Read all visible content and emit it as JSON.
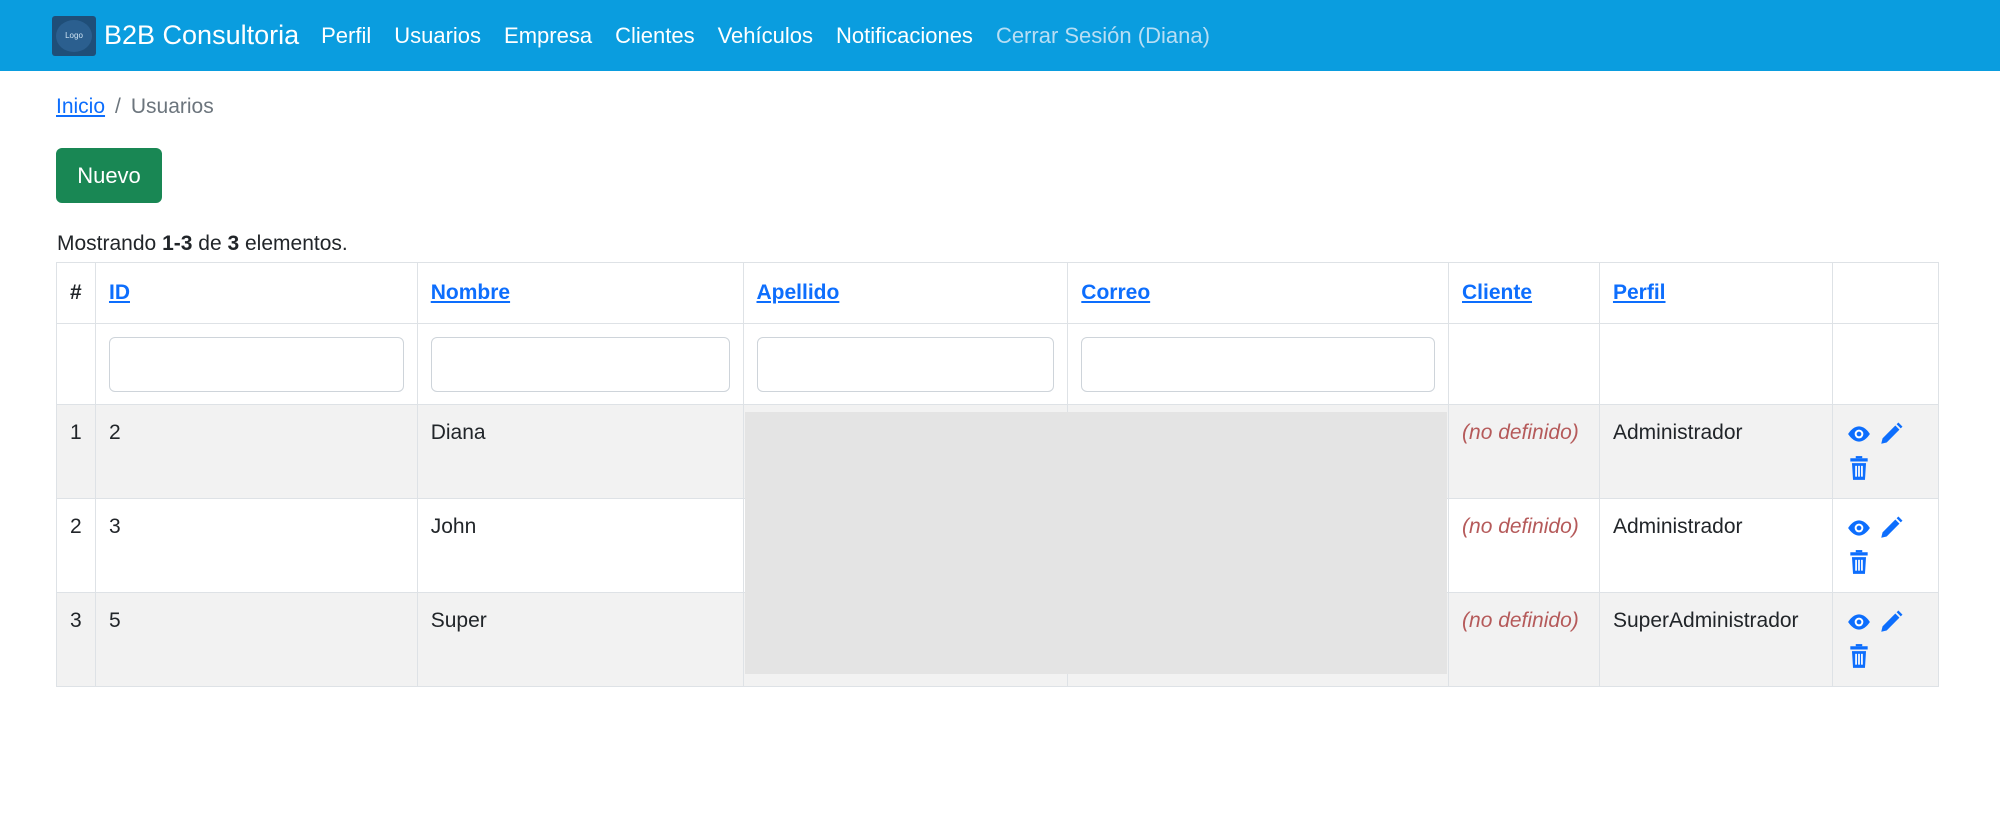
{
  "navbar": {
    "logo_text": "Logo",
    "brand": "B2B Consultoria",
    "links": [
      "Perfil",
      "Usuarios",
      "Empresa",
      "Clientes",
      "Vehículos",
      "Notificaciones"
    ],
    "logout": "Cerrar Sesión (Diana)"
  },
  "breadcrumb": {
    "home": "Inicio",
    "separator": "/",
    "current": "Usuarios"
  },
  "new_button": "Nuevo",
  "summary": {
    "prefix": "Mostrando",
    "range": "1-3",
    "middle": "de",
    "total": "3",
    "suffix": "elementos."
  },
  "table": {
    "headers": [
      "#",
      "ID",
      "Nombre",
      "Apellido",
      "Correo",
      "Cliente",
      "Perfil"
    ],
    "rows": [
      {
        "num": "1",
        "id": "2",
        "nombre": "Diana",
        "cliente": "(no definido)",
        "perfil": "Administrador"
      },
      {
        "num": "2",
        "id": "3",
        "nombre": "John",
        "cliente": "(no definido)",
        "perfil": "Administrador"
      },
      {
        "num": "3",
        "id": "5",
        "nombre": "Super",
        "cliente": "(no definido)",
        "perfil": "SuperAdministrador"
      }
    ]
  },
  "icons": {
    "view": "eye-icon",
    "edit": "pencil-icon",
    "delete": "trash-icon"
  },
  "colors": {
    "navbar": "#0a9ddf",
    "primary": "#0d6efd",
    "success": "#198754",
    "undefined_text": "#b55a5a"
  }
}
